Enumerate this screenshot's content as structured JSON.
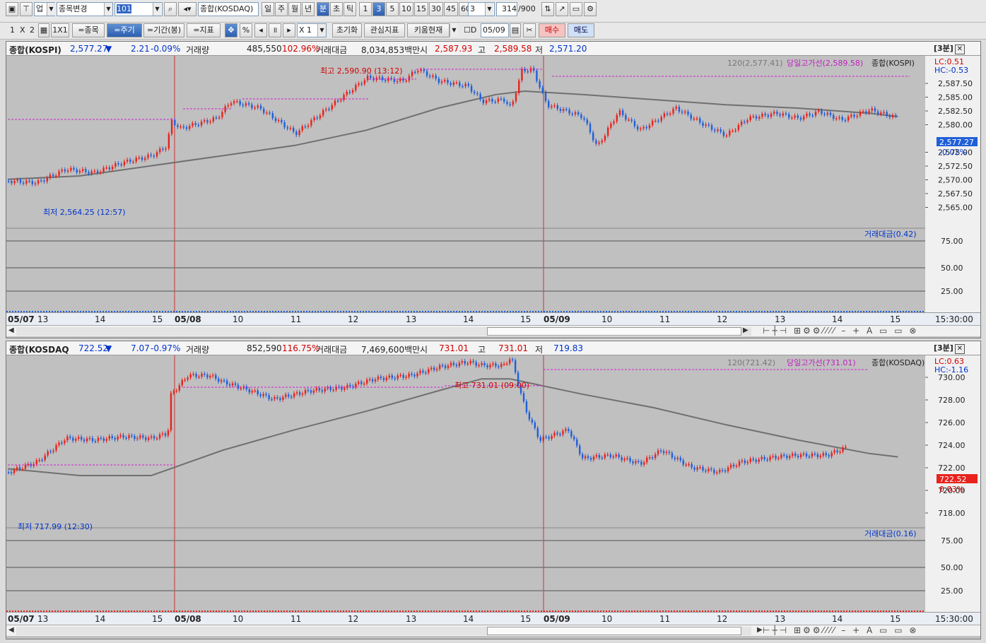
{
  "toolbar1": {
    "window_icon": "window-icon",
    "market_select": "업",
    "symbol_btn": "종목변경",
    "code_value": "101",
    "symbol_name": "종합(KOSDAQ)",
    "periods": [
      "일",
      "주",
      "월",
      "년",
      "분",
      "초",
      "틱"
    ],
    "minute_values": [
      "1",
      "3",
      "5",
      "10",
      "15",
      "30",
      "45",
      "60"
    ],
    "interval_value": "3",
    "count_value": "314",
    "count_total": "/900"
  },
  "toolbar2": {
    "layout_1": "1",
    "layout_x": "X",
    "layout_2": "2",
    "one_by_one": "1X1",
    "stock_btn": "=종목",
    "period_btn": "=주기",
    "range_btn": "=기간(봉)",
    "indicator_btn": "=지표",
    "percent": "%",
    "multiplier": "X 1",
    "reset_btn": "초기화",
    "interest_btn": "관심지표",
    "kiwoom_btn": "키움현재",
    "d_label": "D",
    "date_value": "05/09",
    "buy_btn": "매수",
    "sell_btn": "매도"
  },
  "panel1": {
    "name": "종합(KOSPI)",
    "price": "2,577.27",
    "arrow": "▼",
    "change": "2.21",
    "change_pct": "-0.09%",
    "vol_label": "거래량",
    "volume": "485,550",
    "vol_pct": "102.96%",
    "amount_label": "거래대금",
    "amount": "8,034,853백만",
    "open_label": "시",
    "open": "2,587.93",
    "high_label": "고",
    "high": "2,589.58",
    "low_label": "저",
    "low": "2,571.20",
    "tag": "[3분]",
    "legend_ma": "120(2,577.41)",
    "legend_high": "당일고가선(2,589.58)",
    "legend_name": "종합(KOSPI)",
    "lc": "LC:0.51",
    "hc": "HC:-0.53",
    "high_note": "최고 2,590.90 (13:12)",
    "low_note": "최저 2,564.25 (12:57)",
    "price_tag": "2,577.27",
    "pct_tag": "-0.02%",
    "y_ticks": [
      "2,587.50",
      "2,585.00",
      "2,582.50",
      "2,580.00",
      "2,575.00",
      "2,572.50",
      "2,570.00",
      "2,567.50",
      "2,565.00"
    ],
    "sub_label": "거래대금(0.42)",
    "sub_ticks": [
      "75.00",
      "50.00",
      "25.00"
    ],
    "time_labels": [
      "05/07",
      "13",
      "14",
      "15",
      "05/08",
      "10",
      "11",
      "12",
      "13",
      "14",
      "15",
      "05/09",
      "10",
      "11",
      "12",
      "13",
      "14",
      "15"
    ],
    "end_time": "15:30:00"
  },
  "panel2": {
    "name": "종합(KOSDAQ",
    "price": "722.52",
    "arrow": "▼",
    "change": "7.07",
    "change_pct": "-0.97%",
    "vol_label": "거래량",
    "volume": "852,590",
    "vol_pct": "116.75%",
    "amount_label": "거래대금",
    "amount": "7,469,600백만",
    "open_label": "시",
    "open": "731.01",
    "high_label": "고",
    "high": "731.01",
    "low_label": "저",
    "low": "719.83",
    "tag": "[3분]",
    "legend_ma": "120(721.42)",
    "legend_high": "당일고가선(731.01)",
    "legend_name": "종합(KOSDAQ)",
    "lc": "LC:0.63",
    "hc": "HC:-1.16",
    "high_note": "최고 731.01 (09:00)",
    "low_note": "최저 717.99 (12:30)",
    "price_tag": "722.52",
    "pct_tag": "0.03%",
    "y_ticks": [
      "730.00",
      "728.00",
      "726.00",
      "724.00",
      "722.00",
      "720.00",
      "718.00"
    ],
    "sub_label": "거래대금(0.16)",
    "sub_ticks": [
      "75.00",
      "50.00",
      "25.00"
    ],
    "time_labels": [
      "05/07",
      "13",
      "14",
      "15",
      "05/08",
      "10",
      "11",
      "12",
      "13",
      "14",
      "15",
      "05/09",
      "10",
      "11",
      "12",
      "13",
      "14",
      "15"
    ],
    "end_time": "15:30:00"
  },
  "colors": {
    "up": "#e8221c",
    "down": "#1f5fd8",
    "ma": "#707070",
    "highline": "#d020d0"
  }
}
